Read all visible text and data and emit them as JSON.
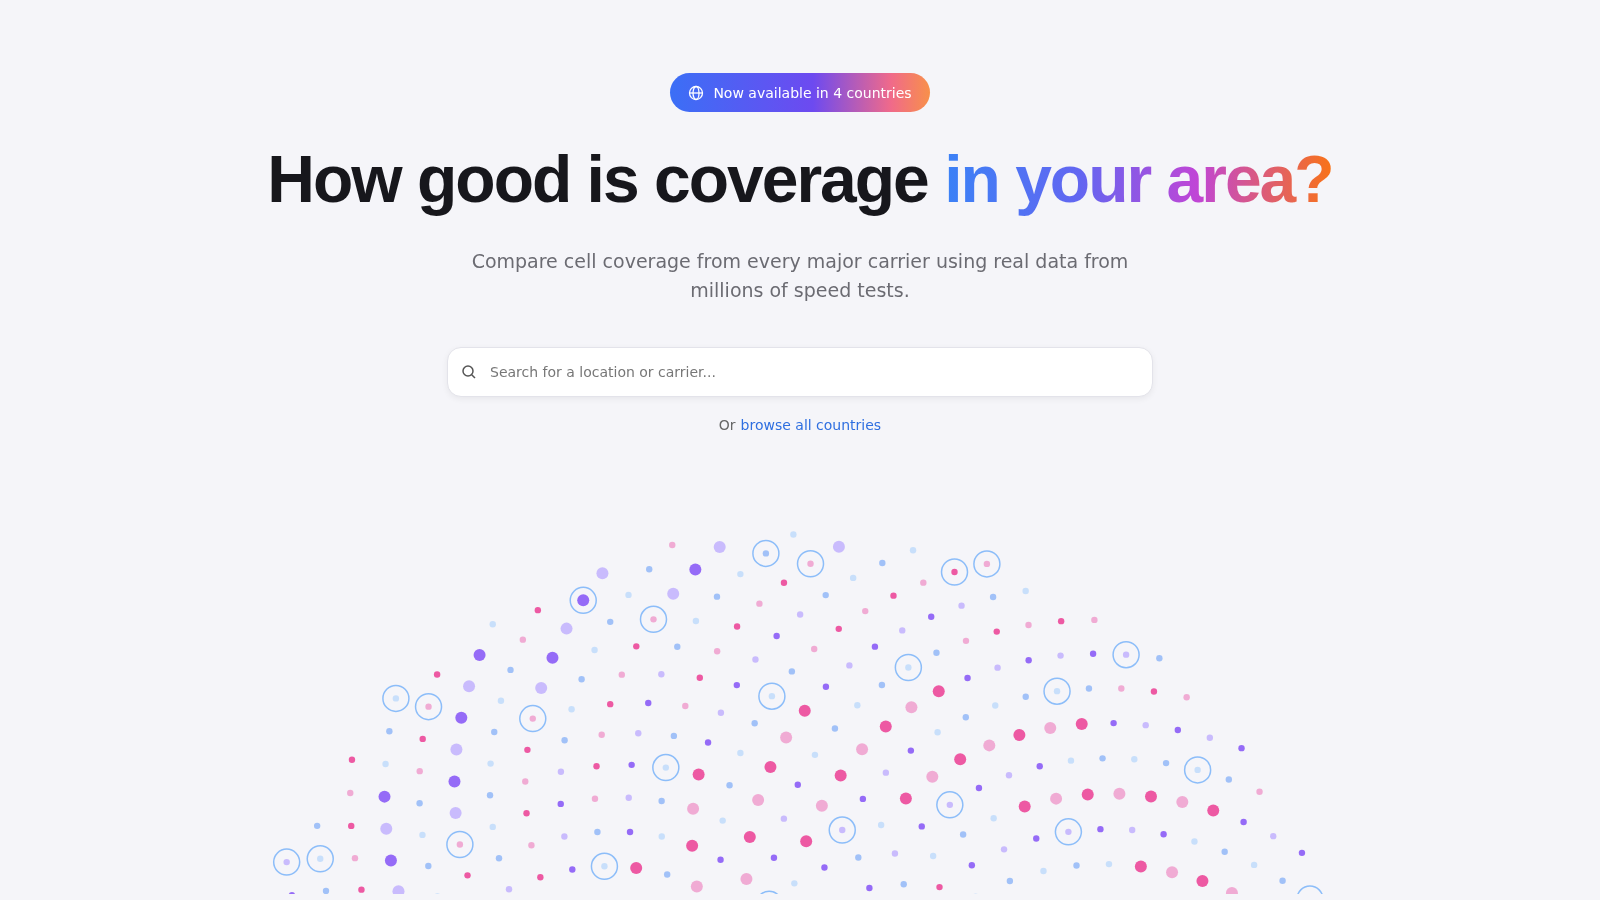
{
  "badge": {
    "label": "Now available in 4 countries"
  },
  "heading": {
    "text": "How good is coverage",
    "highlight": "in your area?"
  },
  "subtitle": "Compare cell coverage from every major carrier using real data from millions of speed tests.",
  "search": {
    "placeholder": "Search for a location or carrier..."
  },
  "browse": {
    "prefix": "Or",
    "link": "browse all countries"
  }
}
